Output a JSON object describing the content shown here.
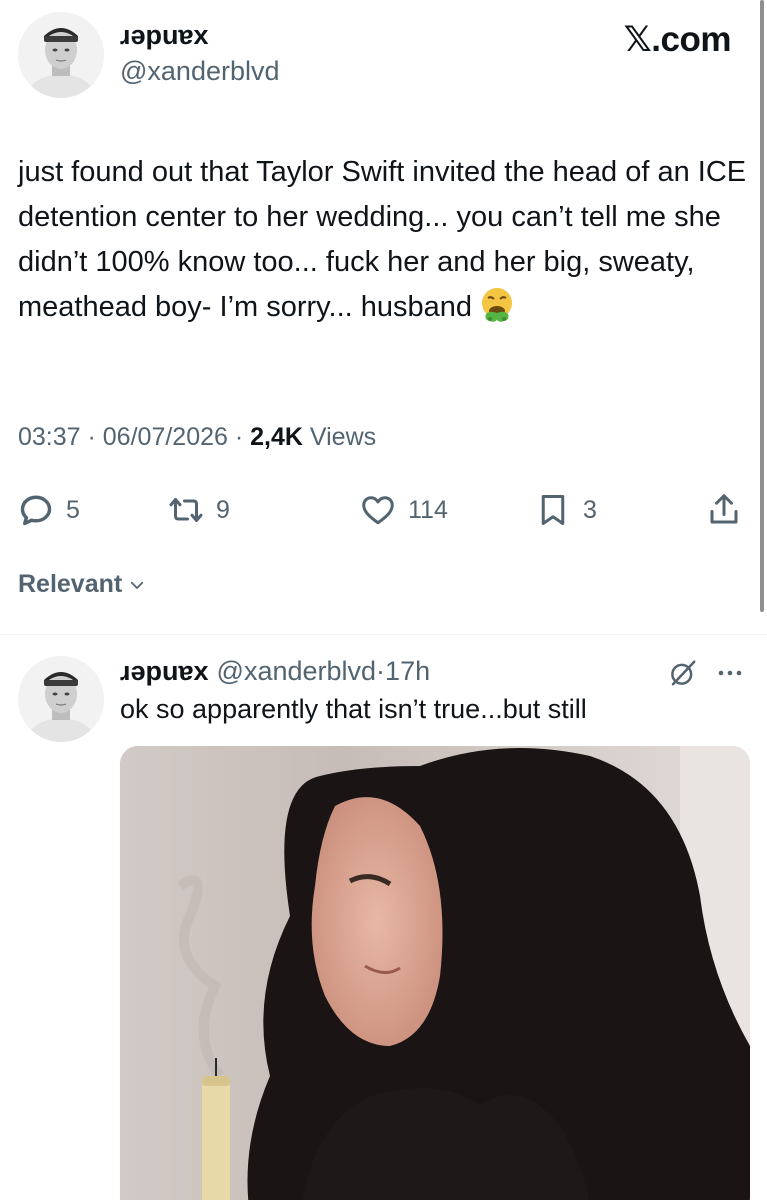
{
  "main_tweet": {
    "display_name": "ɹǝpuɐx",
    "handle": "@xanderblvd",
    "site_brand": "𝕏.com",
    "text": "just found out that Taylor Swift invited the head of an ICE detention center to her wedding... you can’t tell me she didn’t 100% know too... fuck her and her big, sweaty, meathead boy- I’m sorry... husband",
    "emoji_icon": "vomiting-face-emoji",
    "time": "03:37",
    "separator": " · ",
    "date": "06/07/2026",
    "views_count": "2,4K",
    "views_label": " Views",
    "actions": {
      "replies": "5",
      "reposts": "9",
      "likes": "114",
      "bookmarks": "3"
    }
  },
  "sort": {
    "label": "Relevant"
  },
  "reply_tweet": {
    "display_name": "ɹǝpuɐx",
    "handle": "@xanderblvd",
    "separator": " · ",
    "time_ago": "17h",
    "text": "ok so apparently that isn’t true...but still"
  },
  "colors": {
    "text_primary": "#0f1419",
    "text_secondary": "#536471",
    "divider": "#eff3f4"
  }
}
